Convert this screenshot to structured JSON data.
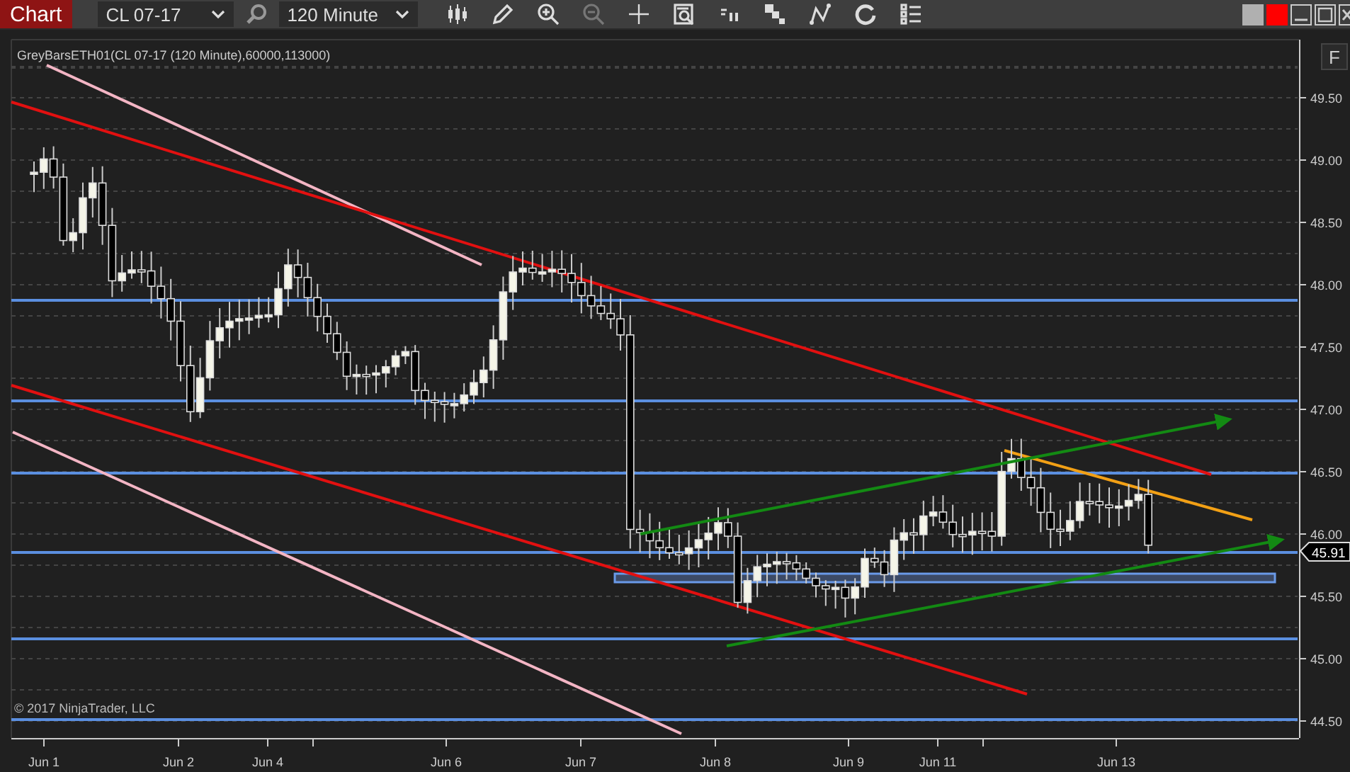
{
  "toolbar": {
    "title": "Chart",
    "instrument": "CL 07-17",
    "interval": "120 Minute"
  },
  "chart": {
    "indicator_label": "GreyBarsETH01(CL 07-17 (120 Minute),60000,113000)",
    "copyright": "© 2017 NinjaTrader, LLC",
    "f_button": "F",
    "price_tag": "45.91",
    "y_axis_labels": [
      "49.50",
      "49.00",
      "48.50",
      "48.00",
      "47.50",
      "47.00",
      "46.50",
      "46.00",
      "45.50",
      "45.00",
      "44.50"
    ],
    "x_axis_labels": [
      "Jun 1",
      "Jun 2",
      "Jun 4",
      "Jun 6",
      "Jun 7",
      "Jun 8",
      "Jun 9",
      "Jun 11",
      "Jun 13"
    ]
  }
}
